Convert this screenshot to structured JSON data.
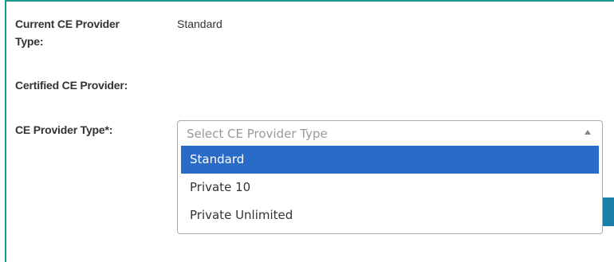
{
  "form": {
    "current_type_label_line1": "Current CE Provider",
    "current_type_label_line2": "Type:",
    "current_type_value": "Standard",
    "certified_label": "Certified CE Provider:",
    "type_label": "CE Provider Type*:"
  },
  "select": {
    "placeholder": "Select CE Provider Type",
    "arrow_icon": "triangle-up",
    "options": [
      {
        "label": "Standard",
        "highlighted": true
      },
      {
        "label": "Private 10",
        "highlighted": false
      },
      {
        "label": "Private Unlimited",
        "highlighted": false
      }
    ]
  },
  "colors": {
    "frame_border": "#1a9a8c",
    "highlight": "#2a6bc7",
    "button": "#1a7fa8"
  }
}
